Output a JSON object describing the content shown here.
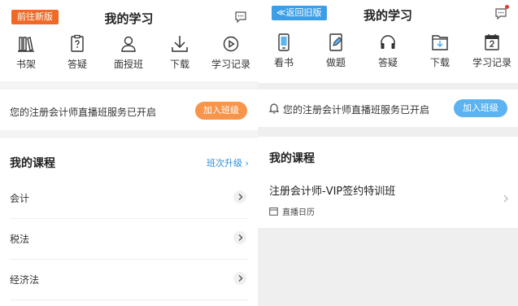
{
  "left": {
    "new_version_btn": "前往新版",
    "title": "我的学习",
    "nav": [
      {
        "label": "书架",
        "icon": "bookshelf-icon"
      },
      {
        "label": "答疑",
        "icon": "clipboard-question-icon"
      },
      {
        "label": "面授班",
        "icon": "teacher-icon"
      },
      {
        "label": "下载",
        "icon": "download-icon"
      },
      {
        "label": "学习记录",
        "icon": "play-record-icon"
      }
    ],
    "notice": "您的注册会计师直播班服务已开启",
    "join_btn": "加入班级",
    "courses_title": "我的课程",
    "upgrade": "班次升级",
    "courses": [
      "会计",
      "税法",
      "经济法"
    ]
  },
  "right": {
    "old_version_btn": "≪返回旧版",
    "title": "我的学习",
    "nav": [
      {
        "label": "看书",
        "icon": "phone-book-icon"
      },
      {
        "label": "做题",
        "icon": "exercise-icon"
      },
      {
        "label": "答疑",
        "icon": "headset-icon"
      },
      {
        "label": "下载",
        "icon": "download-folder-icon"
      },
      {
        "label": "学习记录",
        "icon": "calendar-icon"
      }
    ],
    "notice": "您的注册会计师直播班服务已开启",
    "join_btn": "加入班级",
    "courses_title": "我的课程",
    "course_name": "注册会计师-VIP签约特训班",
    "schedule": "直播日历"
  },
  "colors": {
    "orange": "#f06a26",
    "orange_btn": "#f7954a",
    "blue_btn": "#5cb3f0",
    "link_blue": "#2b8fd8"
  }
}
